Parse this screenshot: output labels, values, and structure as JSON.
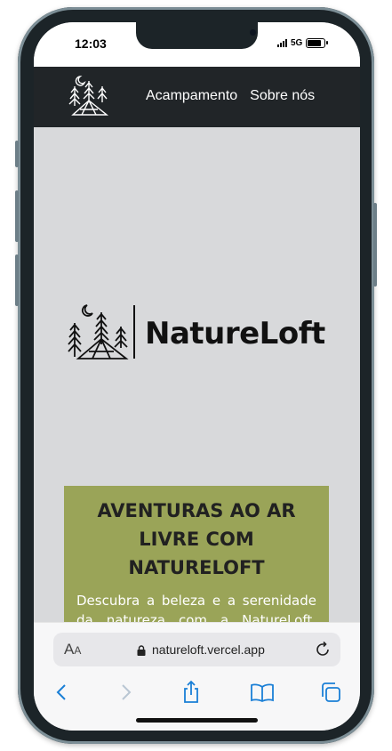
{
  "status_bar": {
    "time": "12:03",
    "network": "5G"
  },
  "nav": {
    "links": [
      "Acampamento",
      "Sobre nós"
    ]
  },
  "hero": {
    "brand": "NatureLoft"
  },
  "promo": {
    "title": "AVENTURAS AO AR LIVRE COM NATURELOFT",
    "text": "Descubra a beleza e a serenidade da natureza com a NatureLoft. Nossas fotos capturam momentos"
  },
  "browser": {
    "aa_large": "A",
    "aa_small": "A",
    "url": "natureloft.vercel.app"
  },
  "colors": {
    "header": "#212528",
    "page_bg": "#d8d9db",
    "promo_bg": "#9aa458",
    "toolbar_accent": "#1a7fd6",
    "toolbar_disabled": "#b9c6d3"
  },
  "icons": {
    "status": [
      "signal-icon",
      "battery-icon"
    ],
    "browser": [
      "lock-icon",
      "reload-icon"
    ],
    "toolbar": [
      "back-icon",
      "forward-icon",
      "share-icon",
      "bookmarks-icon",
      "tabs-icon"
    ]
  }
}
